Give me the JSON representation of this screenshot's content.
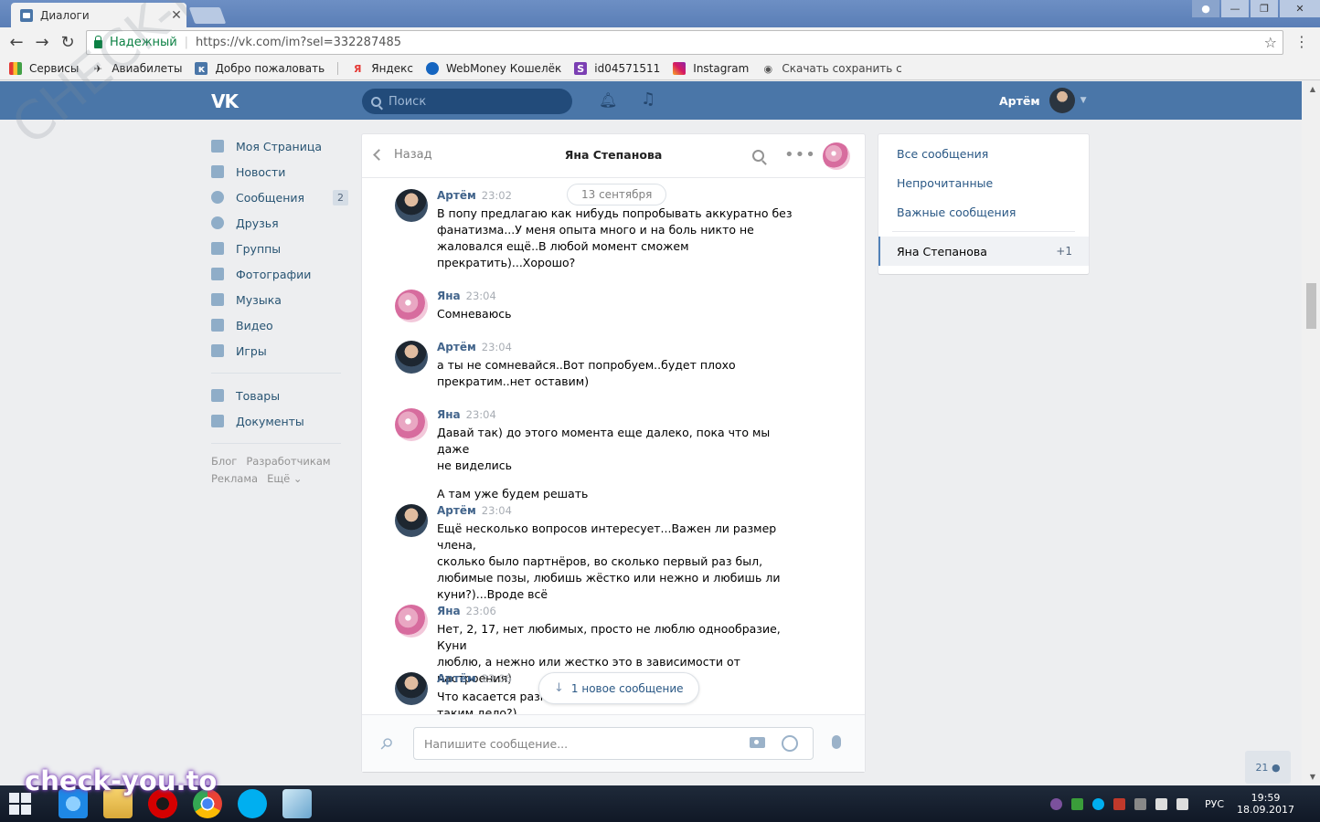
{
  "browser": {
    "tab_title": "Диалоги",
    "tab_close": "✕",
    "secure_label": "Надежный",
    "url": "https://vk.com/im?sel=332287485",
    "bookmarks": [
      "Сервисы",
      "Авиабилеты",
      "Добро пожаловать",
      "Яндекс",
      "WebMoney Кошелёк",
      "id04571511",
      "Instagram",
      "Скачать сохранить с"
    ]
  },
  "vk": {
    "logo": "VK",
    "search_placeholder": "Поиск",
    "user_name": "Артём"
  },
  "leftnav": {
    "items": [
      {
        "label": "Моя Страница",
        "icon": "home-icon"
      },
      {
        "label": "Новости",
        "icon": "news-icon"
      },
      {
        "label": "Сообщения",
        "icon": "messages-icon",
        "badge": "2"
      },
      {
        "label": "Друзья",
        "icon": "friends-icon"
      },
      {
        "label": "Группы",
        "icon": "groups-icon"
      },
      {
        "label": "Фотографии",
        "icon": "photos-icon"
      },
      {
        "label": "Музыка",
        "icon": "music-icon"
      },
      {
        "label": "Видео",
        "icon": "video-icon"
      },
      {
        "label": "Игры",
        "icon": "games-icon"
      }
    ],
    "items2": [
      {
        "label": "Товары",
        "icon": "goods-icon"
      },
      {
        "label": "Документы",
        "icon": "documents-icon"
      }
    ],
    "footer": [
      "Блог",
      "Разработчикам",
      "Реклама",
      "Ещё ⌄"
    ]
  },
  "chat": {
    "back_label": "Назад",
    "title": "Яна Степанова",
    "date_divider": "13 сентября",
    "messages": [
      {
        "author": "Артём",
        "time": "23:02",
        "text": "В попу предлагаю как нибудь попробывать аккуратно без\nфанатизма...У меня опыта много и на боль никто не\nжаловался ещё..В любой момент сможем\nпрекратить)...Хорошо?"
      },
      {
        "author": "Яна",
        "time": "23:04",
        "text": "Сомневаюсь"
      },
      {
        "author": "Артём",
        "time": "23:04",
        "text": "а ты не сомневайся..Вот попробуем..будет плохо\nпрекратим..нет оставим)"
      },
      {
        "author": "Яна",
        "time": "23:04",
        "text": "Давай так) до этого момента еще далеко, пока что мы даже\nне виделись",
        "text2": "А там уже будем решать"
      },
      {
        "author": "Артём",
        "time": "23:04",
        "text": "Ещё несколько вопросов интересует...Важен ли размер члена,\nсколько было партнёров, во сколько первый раз был,\nлюбимые позы, любишь жёстко или нежно и любишь ли\nкуни?)...Вроде всё"
      },
      {
        "author": "Яна",
        "time": "23:06",
        "text": "Нет, 2, 17, нет любимых, просто не люблю однообразие, Куни\nлюблю, а нежно или жестко это в зависимости от настроения)"
      },
      {
        "author": "Артём",
        "time": "23:06",
        "text": "Что касается разм                                          аметр 5..имела с\nтаким дело?)"
      }
    ],
    "new_message_label": "1 новое сообщение",
    "compose_placeholder": "Напишите сообщение..."
  },
  "filters": {
    "items": [
      "Все сообщения",
      "Непрочитанные",
      "Важные сообщения"
    ],
    "conversation": {
      "name": "Яна Степанова",
      "count": "+1"
    }
  },
  "online_count": "21",
  "watermark": {
    "diagonal": "CHECK-YOU.ME",
    "site": "check-you.to"
  },
  "taskbar": {
    "lang": "РУС",
    "time": "19:59",
    "date": "18.09.2017"
  }
}
